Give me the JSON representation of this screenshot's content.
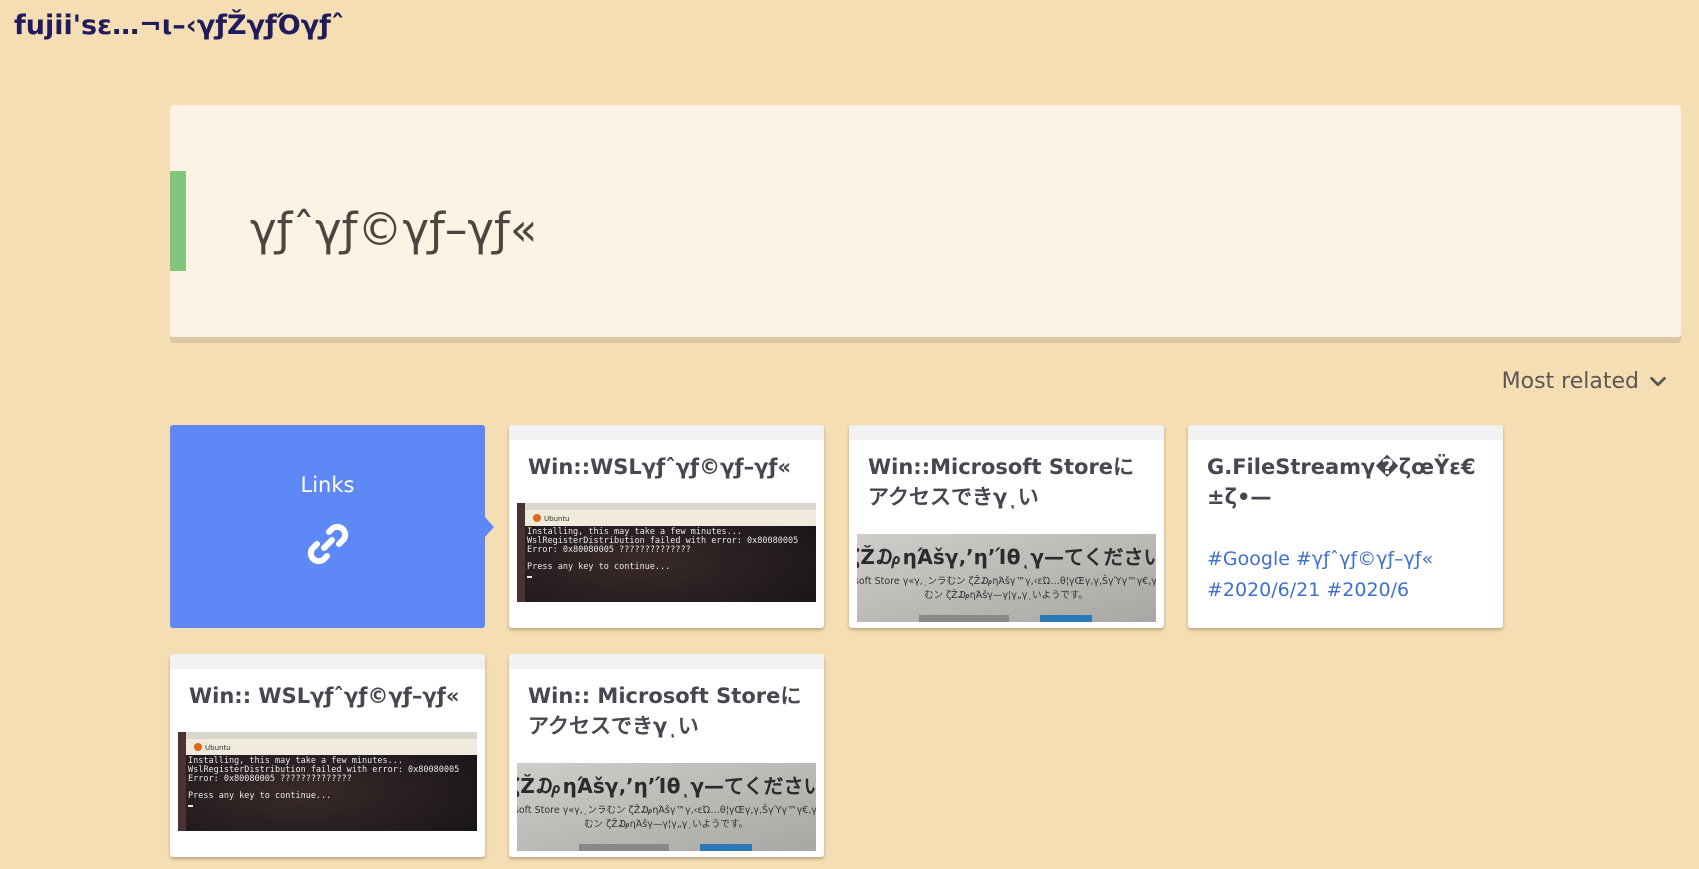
{
  "site": {
    "title": "fujii'sε…¬ι–‹γƒŽγƒΌγƒˆ"
  },
  "page": {
    "title": "γƒˆγƒ©γƒ–γƒ«"
  },
  "sort": {
    "label": "Most related",
    "icon": "chevron-down-icon"
  },
  "links_card": {
    "label": "Links",
    "icon": "link-icon"
  },
  "cards": [
    {
      "title": "Win::WSLγƒˆγƒ©γƒ–γƒ«",
      "thumb": {
        "type": "terminal",
        "window_title": "Ubuntu",
        "lines": [
          "Installing, this may take a few minutes...",
          "WslRegisterDistribution failed with error: 0x80080005",
          "Error: 0x80080005 ??????????????",
          "",
          "Press any key to continue..."
        ]
      }
    },
    {
      "title": "Win::Microsoft Storeにアクセスできγͺい",
      "thumb": {
        "type": "store",
        "heading": "ζŽ₯ηΆšγ‚’η’Ίθͺγ—てください",
        "lines": [
          "Microsoft Store γ«γ‚ͺンラむン ζŽ₯ηΆšγ™γ‚‹εΏ…θ¦γŒγ‚γ‚ŠγΎγ™γ€‚γ‚ͺンラ",
          "むン ζŽ₯ηΆšγ—γ¦γ„γͺいようです。"
        ]
      }
    },
    {
      "title": "G.FileStreamγ�ζœŸε€±ζ•—",
      "tags": [
        "#Google",
        "#γƒˆγƒ©γƒ–γƒ«",
        "#2020/6/21",
        "#2020/6"
      ]
    },
    {
      "title": "Win:: WSLγƒˆγƒ©γƒ–γƒ«",
      "thumb": {
        "type": "terminal",
        "window_title": "Ubuntu",
        "lines": [
          "Installing, this may take a few minutes...",
          "WslRegisterDistribution failed with error: 0x80080005",
          "Error: 0x80080005 ??????????????",
          "",
          "Press any key to continue..."
        ]
      }
    },
    {
      "title": "Win:: Microsoft Storeにアクセスできγͺい",
      "thumb": {
        "type": "store",
        "heading": "ζŽ₯ηΆšγ‚’η’Ίθͺγ—てください",
        "lines": [
          "Microsoft Store γ«γ‚ͺンラむン ζŽ₯ηΆšγ™γ‚‹εΏ…θ¦γŒγ‚γ‚ŠγΎγ™γ€‚γ‚ͺンラ",
          "むン ζŽ₯ηΆšγ—γ¦γ„γͺいようです。"
        ]
      }
    }
  ],
  "colors": {
    "background": "#f5deb3",
    "header_bg": "#fcf3e5",
    "accent_green": "#82c57e",
    "links_blue": "#5e88f5",
    "tag_blue": "#3f6fcf",
    "site_title": "#1f1b5c"
  }
}
